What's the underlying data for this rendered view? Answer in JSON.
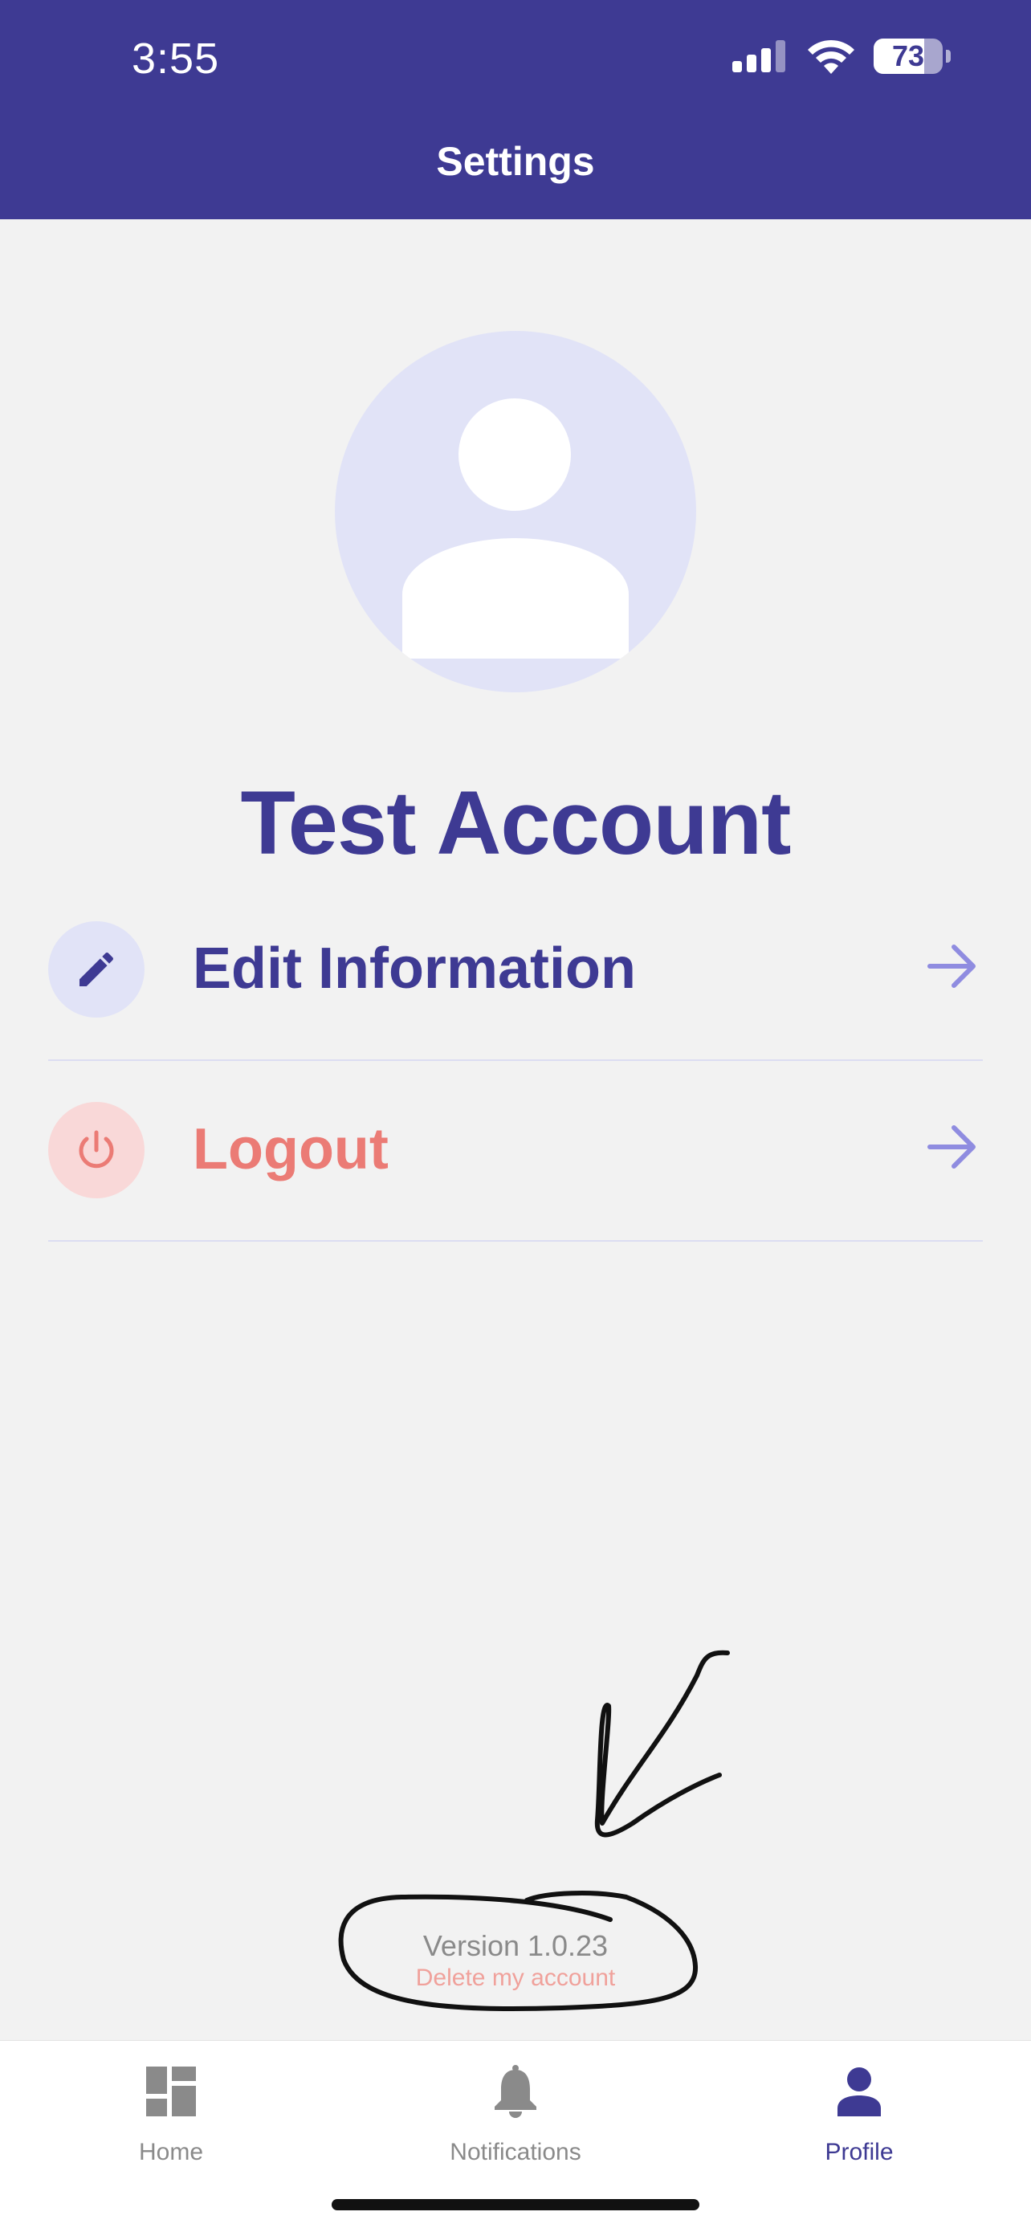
{
  "status_bar": {
    "time": "3:55",
    "battery": "73",
    "icons": [
      "cellular-signal-icon",
      "wifi-icon",
      "battery-icon"
    ]
  },
  "header": {
    "title": "Settings"
  },
  "profile": {
    "name": "Test Account",
    "avatar_icon": "person-icon"
  },
  "menu": {
    "items": [
      {
        "label": "Edit Information",
        "icon": "pencil-icon",
        "trailing_icon": "arrow-right-icon"
      },
      {
        "label": "Logout",
        "icon": "power-icon",
        "trailing_icon": "arrow-right-icon"
      }
    ]
  },
  "footer": {
    "version": "Version 1.0.23",
    "delete_label": "Delete my account"
  },
  "tabbar": {
    "tabs": [
      {
        "label": "Home",
        "icon": "dashboard-icon",
        "active": false
      },
      {
        "label": "Notifications",
        "icon": "bell-icon",
        "active": false
      },
      {
        "label": "Profile",
        "icon": "person-icon",
        "active": true
      }
    ]
  },
  "colors": {
    "primary": "#3E3A93",
    "background": "#F2F2F2",
    "avatar_bg": "#E1E3F7",
    "logout": "#EB7B75",
    "logout_bg": "#F9D8D8",
    "arrow": "#8F8CE0",
    "muted": "#8A8A8A",
    "delete": "#F0A19B"
  }
}
